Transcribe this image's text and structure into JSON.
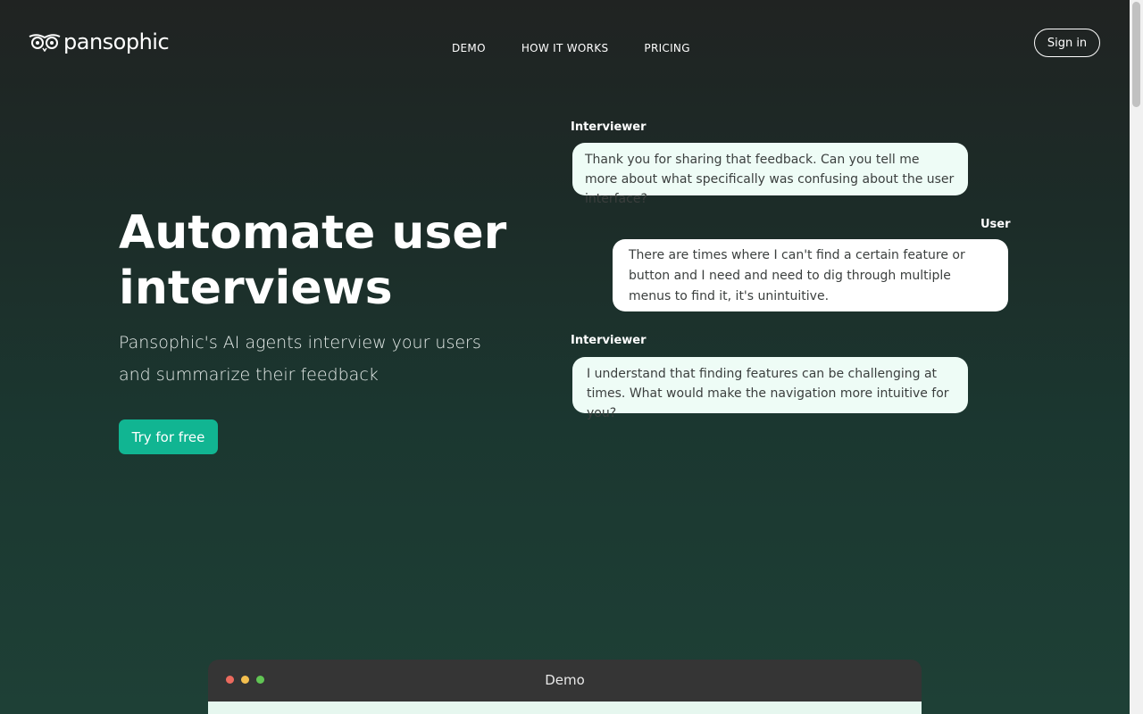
{
  "header": {
    "brand": "pansophic",
    "nav": [
      "DEMO",
      "HOW IT WORKS",
      "PRICING"
    ],
    "sign_in": "Sign in"
  },
  "hero": {
    "title": "Automate user interviews",
    "subtitle": "Pansophic's AI agents interview your users and summarize their feedback",
    "cta": "Try for free"
  },
  "chat": {
    "messages": [
      {
        "speaker": "Interviewer",
        "text": "Thank you for sharing that feedback. Can you tell me more about what specifically was confusing about the user interface?"
      },
      {
        "speaker": "User",
        "text": "There are times where I can't find a certain feature or button and I need and need to dig through multiple menus to find it, it's unintuitive."
      },
      {
        "speaker": "Interviewer",
        "text": "I understand that finding features can be challenging at times. What would make the navigation more intuitive for you?"
      }
    ]
  },
  "demo": {
    "title": "Demo"
  },
  "colors": {
    "accent": "#11b592",
    "bubble_interviewer": "#eefcf6",
    "bubble_user": "#ffffff",
    "dot_red": "#ec6a5e",
    "dot_yellow": "#f4bf4f",
    "dot_green": "#61c554"
  },
  "icons": [
    "owl-logo-icon"
  ]
}
